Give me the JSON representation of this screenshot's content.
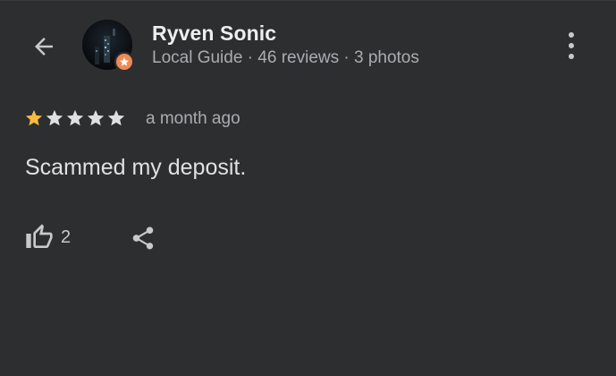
{
  "reviewer": {
    "name": "Ryven Sonic",
    "subtitle": "Local Guide · 46 reviews · 3 photos"
  },
  "review": {
    "rating": 1,
    "max_rating": 5,
    "timestamp": "a month ago",
    "text": "Scammed my deposit."
  },
  "actions": {
    "like_count": "2"
  },
  "icons": {
    "back": "arrow-left-icon",
    "menu": "more-vert-icon",
    "badge": "local-guide-star-icon",
    "like": "thumb-up-icon",
    "share": "share-icon"
  },
  "colors": {
    "background": "#2d2e30",
    "star_filled": "#f6bb42",
    "star_empty": "#e0e0e0",
    "badge": "#ee8a55"
  }
}
